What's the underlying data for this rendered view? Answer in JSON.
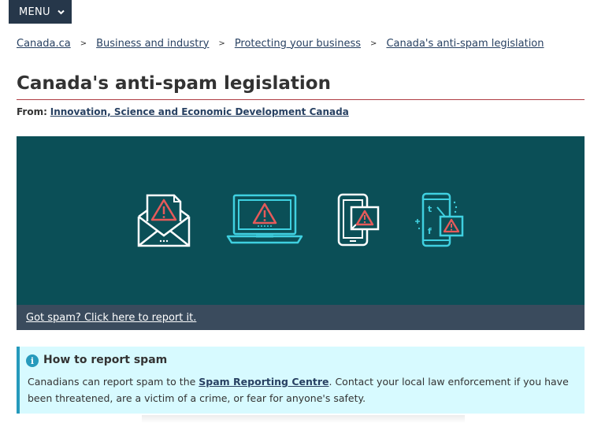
{
  "menu": {
    "label": "MENU"
  },
  "breadcrumb": [
    {
      "label": "Canada.ca"
    },
    {
      "label": "Business and industry"
    },
    {
      "label": "Protecting your business"
    },
    {
      "label": "Canada's anti-spam legislation"
    }
  ],
  "breadcrumb_separator": ">",
  "page": {
    "title": "Canada's anti-spam legislation"
  },
  "from": {
    "label": "From:",
    "org": "Innovation, Science and Economic Development Canada"
  },
  "banner": {
    "icons": [
      "email-warning-icon",
      "laptop-warning-icon",
      "mobile-warning-icon",
      "social-media-warning-icon"
    ],
    "link": "Got spam? Click here to report it.",
    "colors": {
      "background": "#0b4f57",
      "footer": "#3a4b5d",
      "line_white": "#ffffff",
      "line_cyan": "#3fd0e0",
      "warning": "#e65a5a"
    },
    "social_letters": {
      "t": "t",
      "f": "f"
    }
  },
  "alert": {
    "title": "How to report spam",
    "text_before": "Canadians can report spam to the ",
    "link": "Spam Reporting Centre",
    "text_after": ". Contact your local law enforcement if you have been threatened, are a victim of a crime, or fear for anyone's safety."
  },
  "colors": {
    "menu_bg": "#26374a",
    "link": "#284162",
    "title_rule": "#af3c43",
    "alert_bg": "#d7faff",
    "alert_border": "#269abc"
  }
}
